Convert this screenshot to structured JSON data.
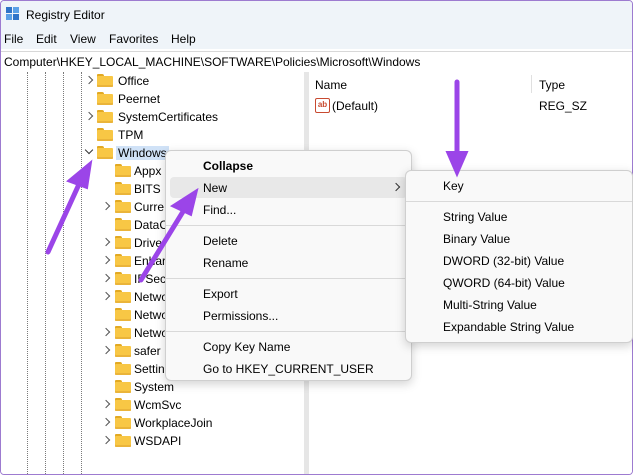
{
  "window": {
    "title": "Registry Editor"
  },
  "menubar": [
    "File",
    "Edit",
    "View",
    "Favorites",
    "Help"
  ],
  "address": "Computer\\HKEY_LOCAL_MACHINE\\SOFTWARE\\Policies\\Microsoft\\Windows",
  "tree": {
    "items": [
      {
        "label": "Office",
        "expander": "collapsed"
      },
      {
        "label": "Peernet",
        "expander": "none"
      },
      {
        "label": "SystemCertificates",
        "expander": "collapsed"
      },
      {
        "label": "TPM",
        "expander": "none"
      },
      {
        "label": "Windows",
        "expander": "expanded",
        "selected": true
      },
      {
        "label": "Appx",
        "expander": "none"
      },
      {
        "label": "BITS",
        "expander": "none"
      },
      {
        "label": "Curre",
        "expander": "collapsed"
      },
      {
        "label": "DataC",
        "expander": "none"
      },
      {
        "label": "Driver",
        "expander": "collapsed"
      },
      {
        "label": "Enhar",
        "expander": "collapsed"
      },
      {
        "label": "IPSec",
        "expander": "collapsed"
      },
      {
        "label": "Netwo",
        "expander": "collapsed"
      },
      {
        "label": "Netwo",
        "expander": "none"
      },
      {
        "label": "Netwo",
        "expander": "collapsed"
      },
      {
        "label": "safer",
        "expander": "collapsed"
      },
      {
        "label": "Settin",
        "expander": "none"
      },
      {
        "label": "System",
        "expander": "none"
      },
      {
        "label": "WcmSvc",
        "expander": "collapsed"
      },
      {
        "label": "WorkplaceJoin",
        "expander": "collapsed"
      },
      {
        "label": "WSDAPI",
        "expander": "collapsed"
      }
    ]
  },
  "list": {
    "columns": [
      "Name",
      "Type"
    ],
    "rows": [
      {
        "name": "(Default)",
        "type": "REG_SZ",
        "icon": "string-value-icon"
      }
    ]
  },
  "context_menu": {
    "items": [
      {
        "label": "Collapse",
        "bold": true
      },
      {
        "label": "New",
        "submenu": true,
        "hover": true
      },
      {
        "label": "Find..."
      },
      {
        "separator": true
      },
      {
        "label": "Delete"
      },
      {
        "label": "Rename"
      },
      {
        "separator": true
      },
      {
        "label": "Export"
      },
      {
        "label": "Permissions..."
      },
      {
        "separator": true
      },
      {
        "label": "Copy Key Name"
      },
      {
        "label": "Go to HKEY_CURRENT_USER"
      }
    ]
  },
  "new_submenu": {
    "items": [
      {
        "label": "Key"
      },
      {
        "separator": true
      },
      {
        "label": "String Value"
      },
      {
        "label": "Binary Value"
      },
      {
        "label": "DWORD (32-bit) Value"
      },
      {
        "label": "QWORD (64-bit) Value"
      },
      {
        "label": "Multi-String Value"
      },
      {
        "label": "Expandable String Value"
      }
    ]
  },
  "colors": {
    "annotation_arrow": "#9b45e8",
    "selection": "#d0e2f7",
    "folder": "#f8c745"
  }
}
